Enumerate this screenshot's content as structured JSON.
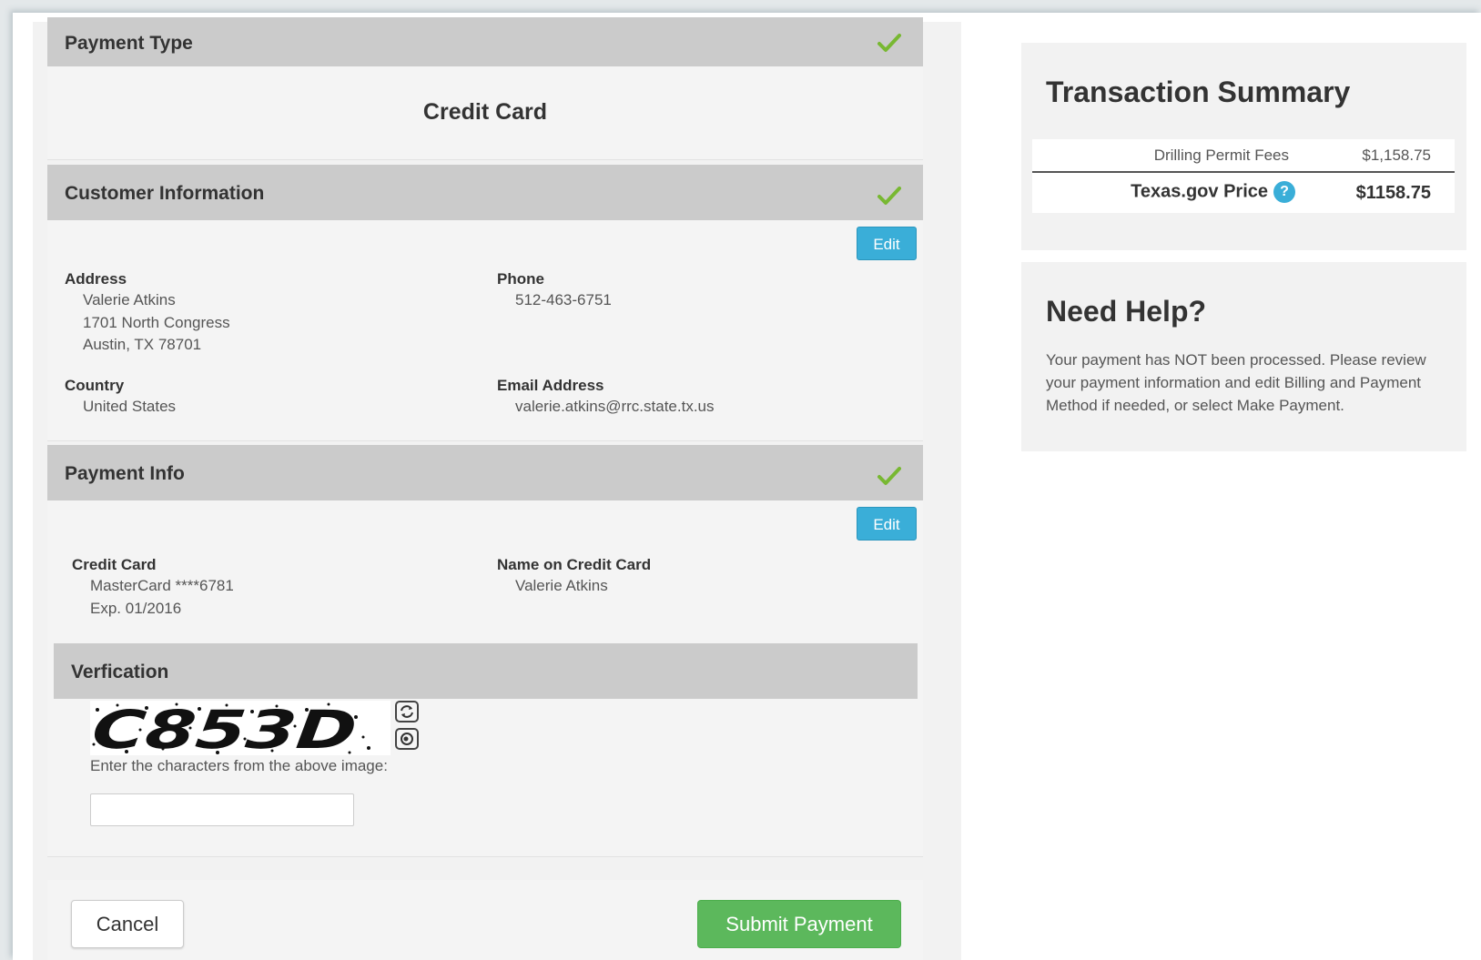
{
  "payment_type": {
    "header": "Payment Type",
    "value": "Credit Card"
  },
  "customer_info": {
    "header": "Customer Information",
    "edit_label": "Edit",
    "address_label": "Address",
    "address_lines": [
      "Valerie Atkins",
      "1701 North Congress",
      "Austin, TX 78701"
    ],
    "phone_label": "Phone",
    "phone": "512-463-6751",
    "country_label": "Country",
    "country": "United States",
    "email_label": "Email Address",
    "email": "valerie.atkins@rrc.state.tx.us"
  },
  "payment_info": {
    "header": "Payment Info",
    "edit_label": "Edit",
    "card_label": "Credit Card",
    "card_number": "MasterCard ****6781",
    "card_expiry": "Exp. 01/2016",
    "name_label": "Name on Credit Card",
    "name": "Valerie Atkins"
  },
  "verification": {
    "header": "Verfication",
    "captcha_text": "C853D",
    "instruction": "Enter the characters from the above image:",
    "input_value": ""
  },
  "actions": {
    "cancel_label": "Cancel",
    "submit_label": "Submit Payment"
  },
  "summary": {
    "title": "Transaction Summary",
    "fee_label": "Drilling Permit Fees",
    "fee_amount": "$1,158.75",
    "price_label": "Texas.gov Price",
    "price_amount": "$1158.75",
    "help_icon_glyph": "?"
  },
  "help": {
    "title": "Need Help?",
    "text": "Your payment has NOT been processed. Please review your payment information and edit Billing and Payment Method if needed, or select Make Payment."
  },
  "colors": {
    "accent_blue": "#3aaed8",
    "success_green": "#5cb85c",
    "check_green": "#78b832",
    "header_gray": "#cbcbcb"
  },
  "icons": {
    "check": "check-icon",
    "refresh": "refresh-icon",
    "audio": "audio-icon",
    "help": "question-circle-icon"
  }
}
